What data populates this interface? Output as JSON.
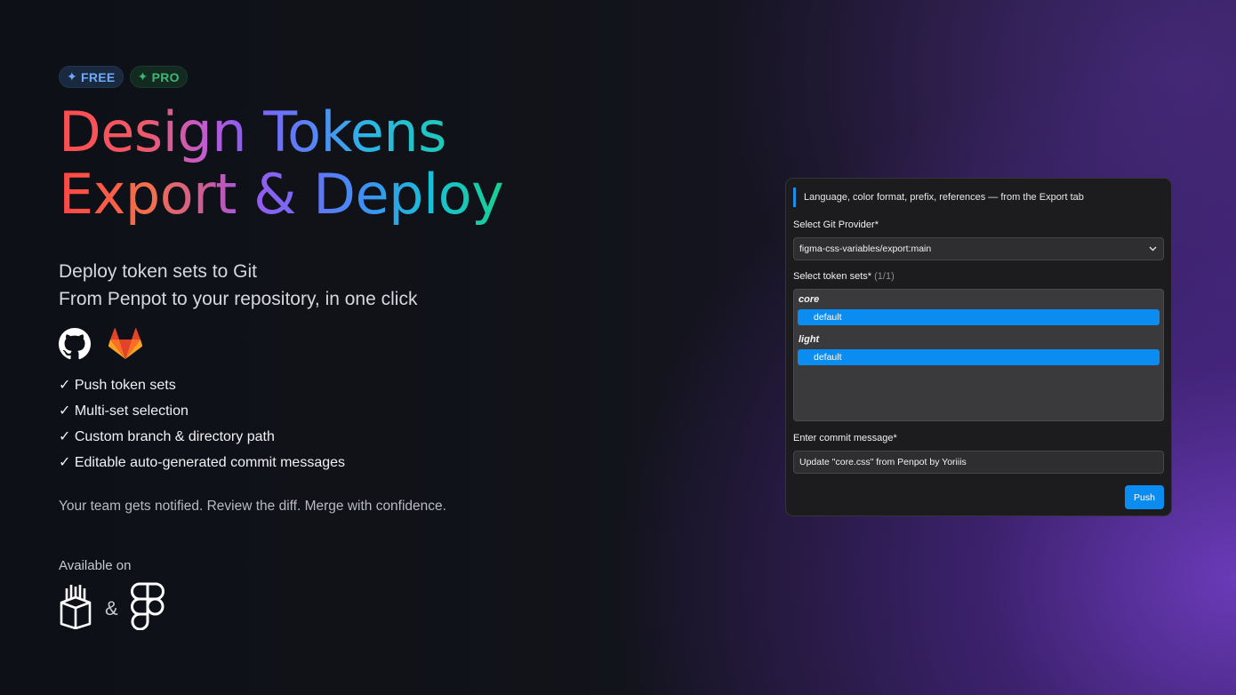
{
  "badges": {
    "free": "FREE",
    "pro": "PRO",
    "spark": "✦"
  },
  "headline": {
    "line1": "Design Tokens",
    "line2": "Export & Deploy"
  },
  "subtitle": {
    "line1": "Deploy token sets to Git",
    "line2": "From Penpot to your repository, in one click"
  },
  "features": [
    "✓ Push token sets",
    "✓ Multi-set selection",
    "✓ Custom branch & directory path",
    "✓ Editable auto-generated commit messages"
  ],
  "tagline": "Your team gets notified. Review the diff. Merge with confidence.",
  "available": {
    "label": "Available on",
    "amp": "&"
  },
  "panel": {
    "info": "Language, color format, prefix, references — from the Export tab",
    "provider_label": "Select Git Provider*",
    "provider_value": "figma-css-variables/export:main",
    "sets_label": "Select token sets*",
    "sets_count": "(1/1)",
    "groups": [
      {
        "name": "core",
        "option": "default"
      },
      {
        "name": "light",
        "option": "default"
      }
    ],
    "commit_label": "Enter commit message*",
    "commit_value": "Update \"core.css\" from Penpot by Yoriiis",
    "push_label": "Push"
  },
  "colors": {
    "accent": "#0b8cf0",
    "free_badge": "#6fa9ff",
    "pro_badge": "#3fb57a"
  },
  "icons": [
    "github-icon",
    "gitlab-icon",
    "penpot-icon",
    "figma-icon",
    "chevron-down-icon"
  ]
}
